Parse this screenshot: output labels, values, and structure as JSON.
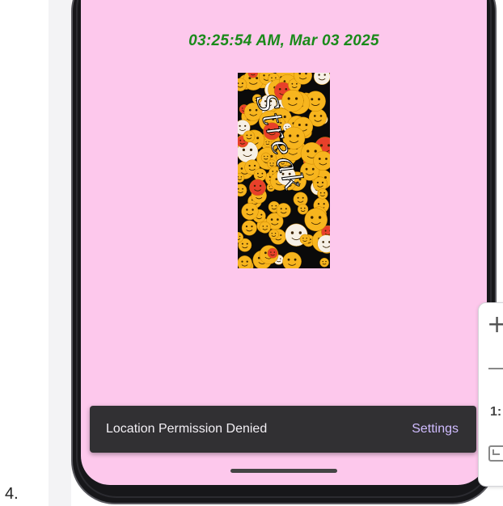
{
  "list_marker": "4.",
  "app": {
    "datetime": "03:25:54 AM, Mar 03 2025",
    "image_text": "Streak",
    "colors": {
      "background": "#fdc8ec",
      "datetime": "#1a8a1a"
    }
  },
  "snackbar": {
    "message": "Location Permission Denied",
    "action_label": "Settings"
  },
  "emulator_toolbar": {
    "zoom_in_icon": "plus-icon",
    "zoom_out_icon": "minus-icon",
    "ratio_label": "1:",
    "fit_icon": "fit-screen-icon"
  }
}
